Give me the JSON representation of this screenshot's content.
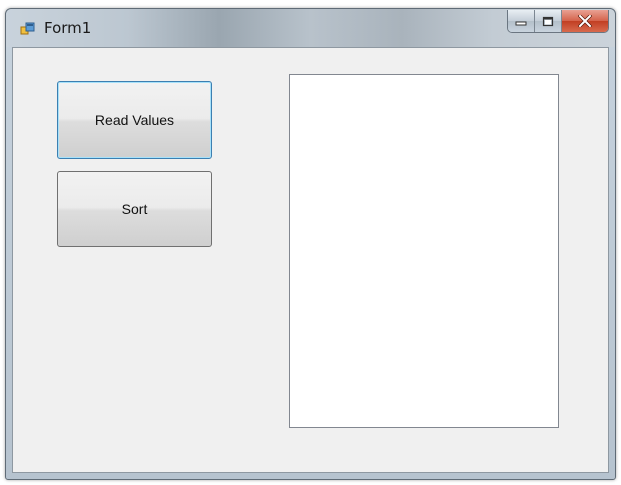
{
  "window": {
    "title": "Form1",
    "icon": "winforms-app-icon"
  },
  "caption_buttons": {
    "minimize": "minimize-icon",
    "maximize": "maximize-icon",
    "close": "close-icon"
  },
  "form": {
    "read_values_label": "Read Values",
    "sort_label": "Sort",
    "listbox_items": []
  },
  "colors": {
    "close_button": "#c13f23",
    "focus_border": "#3c7fb1",
    "client_background": "#f0f0f0"
  }
}
